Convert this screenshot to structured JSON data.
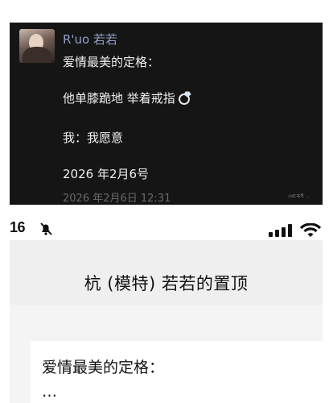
{
  "post": {
    "username": "R'uo 若若",
    "lines": [
      "爱情最美的定格：",
      "他单膝跪地  举着戒指",
      "我：我愿意",
      "2026 年2月6号"
    ],
    "time": "2026 年2月6日 12:31",
    "watermark": "小红书号 …"
  },
  "status_bar": {
    "time": "16",
    "icons": [
      "bell-muted-icon",
      "signal-icon",
      "wifi-icon"
    ]
  },
  "chat": {
    "title": "杭 (模特) 若若的置顶"
  },
  "pinned": {
    "text": "爱情最美的定格：",
    "more": "…"
  },
  "colors": {
    "dark_bg": "#151515",
    "username": "#8fa0c4",
    "header_bg": "#efefef"
  }
}
